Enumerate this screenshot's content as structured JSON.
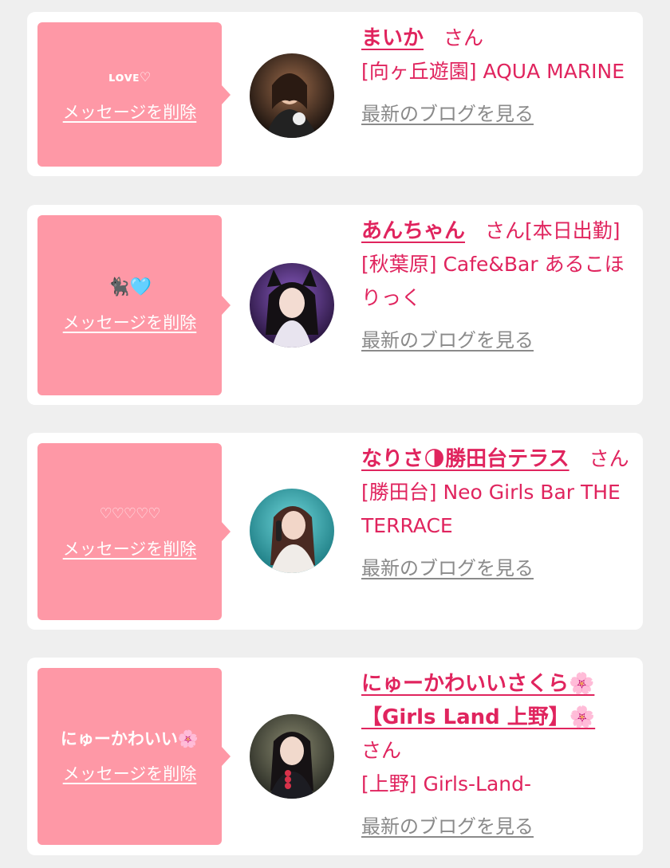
{
  "items": [
    {
      "message": "ʟᴏᴠᴇ♡",
      "delete_label": "メッセージを削除",
      "name": "まいか",
      "suffix": "　さん",
      "shop": "[向ヶ丘遊園] AQUA MARINE",
      "blog_label": "最新のブログを見る"
    },
    {
      "message": "🐈‍⬛🩵",
      "delete_label": "メッセージを削除",
      "name": "あんちゃん",
      "suffix": "　さん[本日出勤]",
      "shop": "[秋葉原] Cafe&Bar あるこほりっく",
      "blog_label": "最新のブログを見る"
    },
    {
      "message": "♡♡♡♡♡",
      "delete_label": "メッセージを削除",
      "name": "なりさ🌗勝田台テラス",
      "suffix": "　さん",
      "shop": "[勝田台] Neo Girls Bar THE TERRACE",
      "blog_label": "最新のブログを見る"
    },
    {
      "message": "にゅーかわいい🌸",
      "delete_label": "メッセージを削除",
      "name": "にゅーかわいいさくら🌸【Girls Land 上野】🌸",
      "suffix": "さん",
      "shop": "[上野] Girls-Land-",
      "blog_label": "最新のブログを見る"
    }
  ],
  "colors": {
    "page_bg": "#efefef",
    "card_bg": "#ffffff",
    "message_bg": "#fe98a6",
    "accent": "#e0245e",
    "muted_link": "#8a8a8a"
  },
  "icons": [
    "avatar-photo"
  ]
}
